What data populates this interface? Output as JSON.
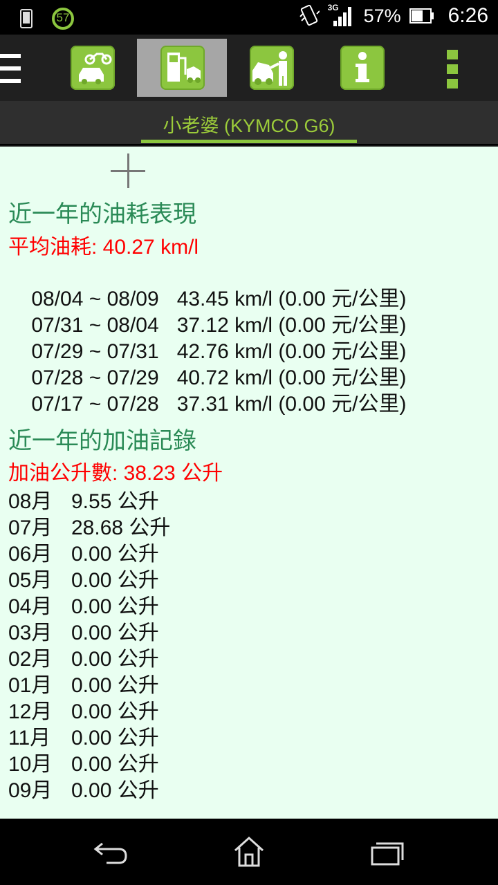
{
  "status_bar": {
    "badge_number": "57",
    "network": "3G",
    "battery": "57%",
    "time": "6:26"
  },
  "toolbar": {
    "tabs": [
      {
        "name": "vehicles",
        "icon": "vehicle-icon",
        "selected": false
      },
      {
        "name": "fuel",
        "icon": "fuel-pump-icon",
        "selected": true
      },
      {
        "name": "maintenance",
        "icon": "repair-icon",
        "selected": false
      },
      {
        "name": "info",
        "icon": "info-icon",
        "selected": false
      }
    ],
    "accent": "#8cc63f"
  },
  "vehicle": {
    "name": "小老婆 (KYMCO G6)"
  },
  "fuel_efficiency": {
    "title": "近一年的油耗表現",
    "average_label": "平均油耗: 40.27 km/l",
    "entries": [
      {
        "range": "08/04 ~ 08/09",
        "value": "43.45 km/l (0.00 元/公里)"
      },
      {
        "range": "07/31 ~ 08/04",
        "value": "37.12 km/l (0.00 元/公里)"
      },
      {
        "range": "07/29 ~ 07/31",
        "value": "42.76 km/l (0.00 元/公里)"
      },
      {
        "range": "07/28 ~ 07/29",
        "value": "40.72 km/l (0.00 元/公里)"
      },
      {
        "range": "07/17 ~ 07/28",
        "value": "37.31 km/l (0.00 元/公里)"
      }
    ]
  },
  "refuel_records": {
    "title": "近一年的加油記錄",
    "total_label": "加油公升數: 38.23 公升",
    "months": [
      {
        "month": "08月",
        "value": "9.55 公升"
      },
      {
        "month": "07月",
        "value": "28.68 公升"
      },
      {
        "month": "06月",
        "value": "0.00 公升"
      },
      {
        "month": "05月",
        "value": "0.00 公升"
      },
      {
        "month": "04月",
        "value": "0.00 公升"
      },
      {
        "month": "03月",
        "value": "0.00 公升"
      },
      {
        "month": "02月",
        "value": "0.00 公升"
      },
      {
        "month": "01月",
        "value": "0.00 公升"
      },
      {
        "month": "12月",
        "value": "0.00 公升"
      },
      {
        "month": "11月",
        "value": "0.00 公升"
      },
      {
        "month": "10月",
        "value": "0.00 公升"
      },
      {
        "month": "09月",
        "value": "0.00 公升"
      }
    ]
  }
}
